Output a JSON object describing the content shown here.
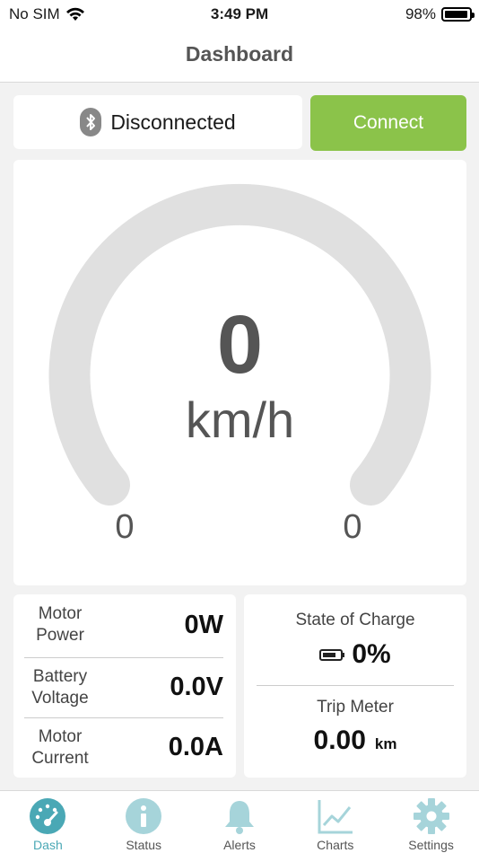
{
  "status_bar": {
    "carrier": "No SIM",
    "time": "3:49 PM",
    "battery_percent": "98%",
    "battery_level": 0.98
  },
  "nav": {
    "title": "Dashboard"
  },
  "connection": {
    "status_label": "Disconnected",
    "connect_label": "Connect",
    "connect_color": "#8bc34a",
    "icon": "bluetooth-icon"
  },
  "speedometer": {
    "value": "0",
    "unit": "km/h",
    "min_label": "0",
    "max_label": "0",
    "level": 0,
    "track_color": "#e0e0e0"
  },
  "stats": {
    "motor_power": {
      "label": "Motor Power",
      "value": "0W"
    },
    "battery_voltage": {
      "label": "Battery Voltage",
      "value": "0.0V"
    },
    "motor_current": {
      "label": "Motor Current",
      "value": "0.0A"
    }
  },
  "charge": {
    "label": "State of Charge",
    "value": "0%",
    "icon": "battery-icon"
  },
  "trip": {
    "label": "Trip Meter",
    "value": "0.00",
    "unit": "km"
  },
  "tabs": [
    {
      "label": "Dash",
      "icon": "dashboard-gauge-icon",
      "active": true
    },
    {
      "label": "Status",
      "icon": "info-icon",
      "active": false
    },
    {
      "label": "Alerts",
      "icon": "bell-icon",
      "active": false
    },
    {
      "label": "Charts",
      "icon": "line-chart-icon",
      "active": false
    },
    {
      "label": "Settings",
      "icon": "gear-icon",
      "active": false
    }
  ],
  "colors": {
    "accent": "#4aa8b5",
    "inactive_icon": "#a6d4da",
    "connect_green": "#8bc34a"
  }
}
